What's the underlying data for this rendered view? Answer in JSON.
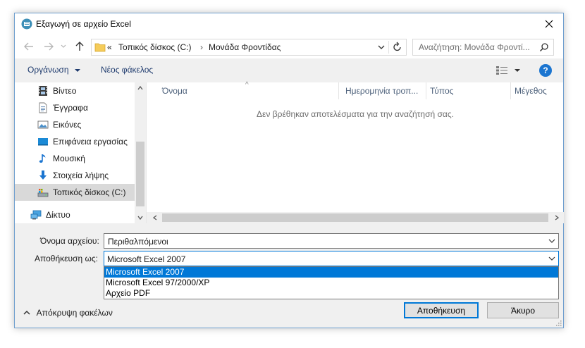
{
  "window": {
    "title": "Εξαγωγή σε αρχείο Excel"
  },
  "address": {
    "overflow": "«",
    "crumbs": [
      "Τοπικός δίσκος (C:)",
      "Μονάδα Φροντίδας"
    ],
    "separator": "›"
  },
  "search": {
    "placeholder": "Αναζήτηση: Μονάδα Φροντί..."
  },
  "toolbar": {
    "organize": "Οργάνωση",
    "new_folder": "Νέος φάκελος"
  },
  "nav": {
    "items": [
      {
        "label": "Βίντεο",
        "icon": "film-icon"
      },
      {
        "label": "Έγγραφα",
        "icon": "document-icon"
      },
      {
        "label": "Εικόνες",
        "icon": "pictures-icon"
      },
      {
        "label": "Επιφάνεια εργασίας",
        "icon": "desktop-icon"
      },
      {
        "label": "Μουσική",
        "icon": "music-icon"
      },
      {
        "label": "Στοιχεία λήψης",
        "icon": "download-icon"
      },
      {
        "label": "Τοπικός δίσκος (C:)",
        "icon": "drive-icon",
        "selected": true
      },
      {
        "label": "Δίκτυο",
        "icon": "network-icon"
      }
    ]
  },
  "files": {
    "columns": [
      "Όνομα",
      "Ημερομηνία τροπ...",
      "Τύπος",
      "Μέγεθος"
    ],
    "empty_message": "Δεν βρέθηκαν αποτελέσματα για την αναζήτησή σας."
  },
  "form": {
    "filename_label": "Όνομα αρχείου:",
    "filename_value": "Περιθαλπόμενοι",
    "savetype_label": "Αποθήκευση ως:",
    "savetype_value": "Microsoft Excel 2007",
    "savetype_options": [
      "Microsoft Excel 2007",
      "Microsoft Excel 97/2000/XP",
      "Αρχείο PDF"
    ]
  },
  "footer": {
    "hide_folders": "Απόκρυψη φακέλων",
    "save": "Αποθήκευση",
    "cancel": "Άκυρο"
  },
  "colors": {
    "accent": "#0078d7",
    "window_bg": "#f0f0f0",
    "selection": "#d9d9d9",
    "help": "#1b75d0"
  }
}
